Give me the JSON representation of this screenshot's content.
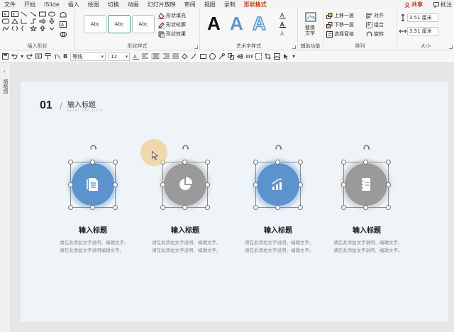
{
  "menu": {
    "items": [
      "文件",
      "开始",
      "iSlide",
      "插入",
      "绘图",
      "切换",
      "动画",
      "幻灯片放映",
      "审阅",
      "视图",
      "录制",
      "形状格式"
    ],
    "active_index": 11,
    "share": "共享",
    "comment": "批注"
  },
  "ribbon": {
    "insert_shapes_label": "插入形状",
    "shape_styles_label": "形状样式",
    "style_samples": [
      "Abc",
      "Abc",
      "Abc"
    ],
    "shape_fill": "形状填充",
    "shape_outline": "形状轮廓",
    "shape_effects": "形状效果",
    "wordart_label": "艺术字样式",
    "wordart_glyph": "A",
    "accessibility_label": "辅助功能",
    "alt_text": "替换\n文字",
    "arrange_label": "排列",
    "bring_forward": "上移一层",
    "send_backward": "下移一层",
    "selection_pane": "选择窗格",
    "align": "对齐",
    "group": "组合",
    "rotate": "旋转",
    "size_label": "大小",
    "height": "3.51 厘米",
    "width": "3.51 厘米"
  },
  "qat": {
    "font_name": "等线",
    "font_size": "12"
  },
  "left_pane": {
    "label": "缩略图"
  },
  "slide": {
    "number": "01",
    "title": "输入标题",
    "subtitle": "Enter the title",
    "items": [
      {
        "title": "输入标题",
        "desc": "请在此添加文字说明、编辑文字、请在此添加文字说明编辑文字。",
        "icon": "document-icon",
        "color": "blue"
      },
      {
        "title": "输入标题",
        "desc": "请在此添加文字说明、编辑文字、请在此添加文字说明、编辑文字。",
        "icon": "pie-chart-icon",
        "color": "gray"
      },
      {
        "title": "输入标题",
        "desc": "请在此添加文字说明、编辑文字、请在此添加文字说明、编辑文字。",
        "icon": "bar-chart-icon",
        "color": "blue"
      },
      {
        "title": "输入标题",
        "desc": "请在此添加文字说明、编辑文字、请在此添加文字说明、编辑文字。",
        "icon": "notebook-icon",
        "color": "gray"
      }
    ]
  },
  "colors": {
    "accent_red": "#c43e1c",
    "circle_blue": "#5c93cd",
    "circle_gray": "#9a9a9a",
    "slide_bg": "#eef4f7"
  }
}
